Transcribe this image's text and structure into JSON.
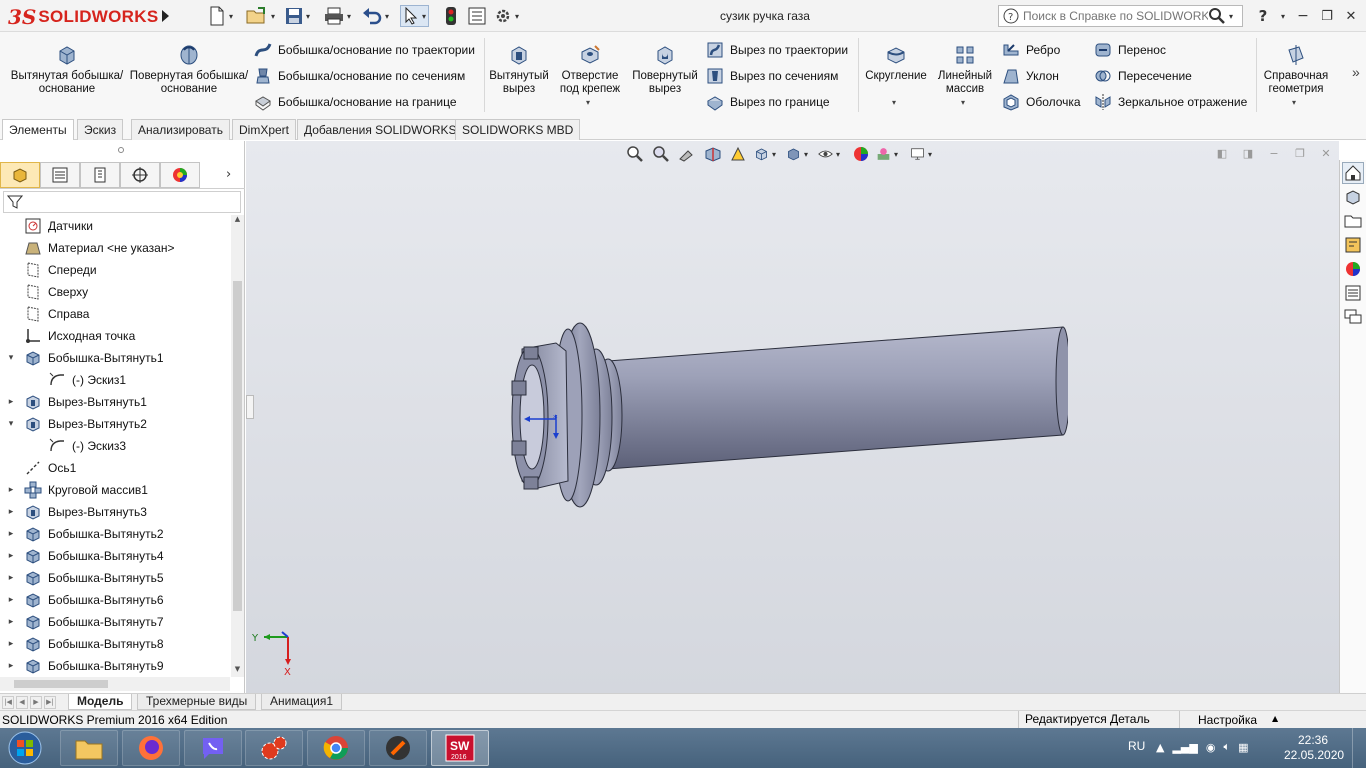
{
  "app": {
    "brand_ds": "3S",
    "brand_name": "SOLIDWORKS",
    "document_title": "сузик ручка газа"
  },
  "help_search": {
    "placeholder": "Поиск в Справке по SOLIDWORKS"
  },
  "window_controls": {
    "help": "?",
    "minimize": "−",
    "restore": "❐",
    "close": "✕"
  },
  "commands": {
    "extruded_boss": "Вытянутая бобышка/основание",
    "revolved_boss": "Повернутая бобышка/основание",
    "swept_boss": "Бобышка/основание по траектории",
    "lofted_boss": "Бобышка/основание по сечениям",
    "boundary_boss": "Бобышка/основание на границе",
    "extruded_cut": "Вытянутый вырез",
    "hole_wizard": "Отверстие под крепеж",
    "revolved_cut": "Повернутый вырез",
    "swept_cut": "Вырез по траектории",
    "lofted_cut": "Вырез по сечениям",
    "boundary_cut": "Вырез по границе",
    "fillet": "Скругление",
    "linear_pattern": "Линейный массив",
    "rib": "Ребро",
    "draft": "Уклон",
    "shell": "Оболочка",
    "wrap": "Перенос",
    "intersect": "Пересечение",
    "mirror": "Зеркальное отражение",
    "reference_geometry": "Справочная геометрия",
    "more": "»"
  },
  "cm_tabs": [
    "Элементы",
    "Эскиз",
    "Анализировать",
    "DimXpert",
    "Добавления SOLIDWORKS",
    "SOLIDWORKS MBD"
  ],
  "tree": [
    {
      "label": "Датчики",
      "icon": "sensors-icon",
      "expand": ""
    },
    {
      "label": "Материал <не указан>",
      "icon": "material-icon",
      "expand": ""
    },
    {
      "label": "Спереди",
      "icon": "plane-icon",
      "expand": ""
    },
    {
      "label": "Сверху",
      "icon": "plane-icon",
      "expand": ""
    },
    {
      "label": "Справа",
      "icon": "plane-icon",
      "expand": ""
    },
    {
      "label": "Исходная точка",
      "icon": "origin-icon",
      "expand": ""
    },
    {
      "label": "Бобышка-Вытянуть1",
      "icon": "boss-extrude-icon",
      "expand": "▾"
    },
    {
      "label": "(-) Эскиз1",
      "icon": "sketch-icon",
      "expand": "",
      "indent": true
    },
    {
      "label": "Вырез-Вытянуть1",
      "icon": "cut-extrude-icon",
      "expand": "▸"
    },
    {
      "label": "Вырез-Вытянуть2",
      "icon": "cut-extrude-icon",
      "expand": "▾"
    },
    {
      "label": "(-) Эскиз3",
      "icon": "sketch-icon",
      "expand": "",
      "indent": true
    },
    {
      "label": "Ось1",
      "icon": "axis-icon",
      "expand": ""
    },
    {
      "label": "Круговой массив1",
      "icon": "circular-pattern-icon",
      "expand": "▸"
    },
    {
      "label": "Вырез-Вытянуть3",
      "icon": "cut-extrude-icon",
      "expand": "▸"
    },
    {
      "label": "Бобышка-Вытянуть2",
      "icon": "boss-extrude-icon",
      "expand": "▸"
    },
    {
      "label": "Бобышка-Вытянуть4",
      "icon": "boss-extrude-icon",
      "expand": "▸"
    },
    {
      "label": "Бобышка-Вытянуть5",
      "icon": "boss-extrude-icon",
      "expand": "▸"
    },
    {
      "label": "Бобышка-Вытянуть6",
      "icon": "boss-extrude-icon",
      "expand": "▸"
    },
    {
      "label": "Бобышка-Вытянуть7",
      "icon": "boss-extrude-icon",
      "expand": "▸"
    },
    {
      "label": "Бобышка-Вытянуть8",
      "icon": "boss-extrude-icon",
      "expand": "▸"
    },
    {
      "label": "Бобышка-Вытянуть9",
      "icon": "boss-extrude-icon",
      "expand": "▸"
    }
  ],
  "triad": {
    "x": "X",
    "y": "Y"
  },
  "bottom_tabs": [
    "Модель",
    "Трехмерные виды",
    "Анимация1"
  ],
  "status": {
    "edition": "SOLIDWORKS Premium 2016 x64 Edition",
    "mode": "Редактируется Деталь",
    "custom": "Настройка"
  },
  "taskbar": {
    "lang": "RU",
    "time": "22:36",
    "date": "22.05.2020",
    "sw_badge": "2016"
  },
  "colors": {
    "brand_red": "#d6241d",
    "model_steel": "#8a8fa6",
    "taskbar": "#4f6c86"
  }
}
